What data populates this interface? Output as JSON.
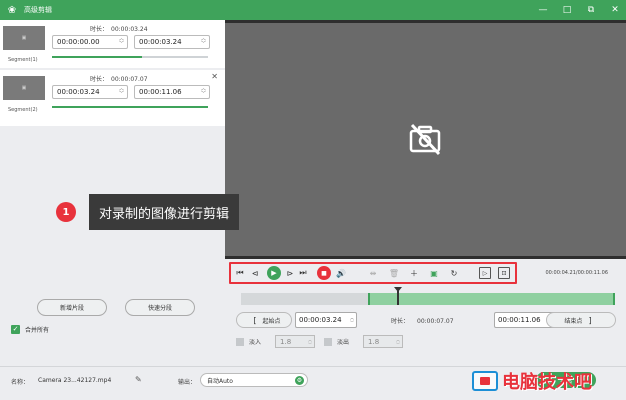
{
  "window": {
    "title": "高级剪辑",
    "controls": [
      "—",
      "□",
      "⧉",
      "✕"
    ]
  },
  "segments": [
    {
      "label": "Segment(1)",
      "duration_label": "时长：",
      "duration": "00:00:03.24",
      "start": "00:00:00.00",
      "end": "00:00:03.24",
      "progress": 0.58
    },
    {
      "label": "Segment(2)",
      "duration_label": "时长：",
      "duration": "00:00:07.07",
      "start": "00:00:03.24",
      "end": "00:00:11.06",
      "progress": 1.0
    }
  ],
  "left_buttons": {
    "add_segment": "新增片段",
    "quick_split": "快速分段",
    "merge_all": "合并所有"
  },
  "callout": {
    "number": "1",
    "text": "对录制的图像进行剪辑"
  },
  "player": {
    "time": "00:00:04.21/00:00:11.06",
    "timeline_selection_start": 0.34,
    "playhead": 0.42
  },
  "trim": {
    "start_label": "起始点",
    "start_time": "00:00:03.24",
    "duration_label": "时长：",
    "duration": "00:00:07.07",
    "end_time": "00:00:11.06",
    "end_label": "结束点"
  },
  "fade": {
    "in_label": "淡入",
    "in_value": "1.8",
    "out_label": "淡出",
    "out_value": "1.8"
  },
  "bottom": {
    "name_label": "名称：",
    "name_value": "Camera 23...42127.mp4",
    "output_label": "输出：",
    "output_value": "自动Auto",
    "export_label": "导出"
  },
  "watermark": {
    "text": "电脑技术吧"
  },
  "colors": {
    "accent": "#3fa35b",
    "highlight": "#e8323c",
    "preview_bg": "#6a6a6a"
  }
}
